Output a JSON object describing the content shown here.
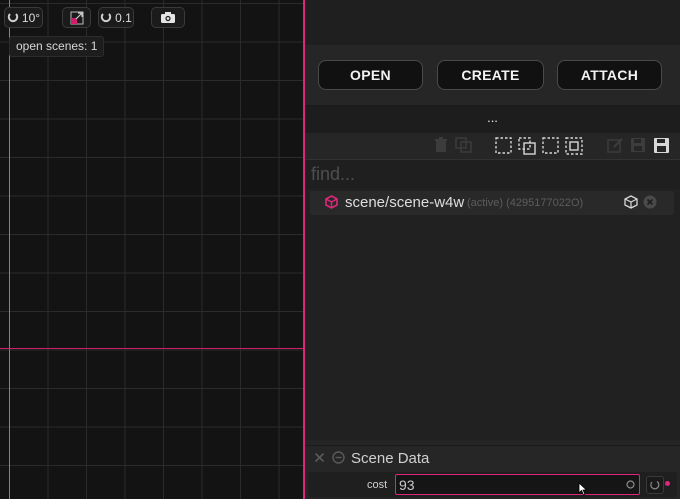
{
  "viewport": {
    "rotate_snap": "10°",
    "move_snap": "0.1",
    "tooltip": "open scenes: 1"
  },
  "panel": {
    "buttons": {
      "open": "OPEN",
      "create": "CREATE",
      "attach": "ATTACH"
    },
    "ellipsis": "...",
    "find": {
      "placeholder": "find...",
      "value": ""
    },
    "scene": {
      "name": "scene/scene-w4w",
      "meta": "(active) (4295177022O)"
    },
    "section": {
      "title": "Scene Data"
    },
    "property": {
      "label": "cost",
      "value": "93"
    }
  },
  "colors": {
    "accent": "#e0267a",
    "axis_x": "#d21d6d",
    "axis_y": "#3fb53f"
  }
}
